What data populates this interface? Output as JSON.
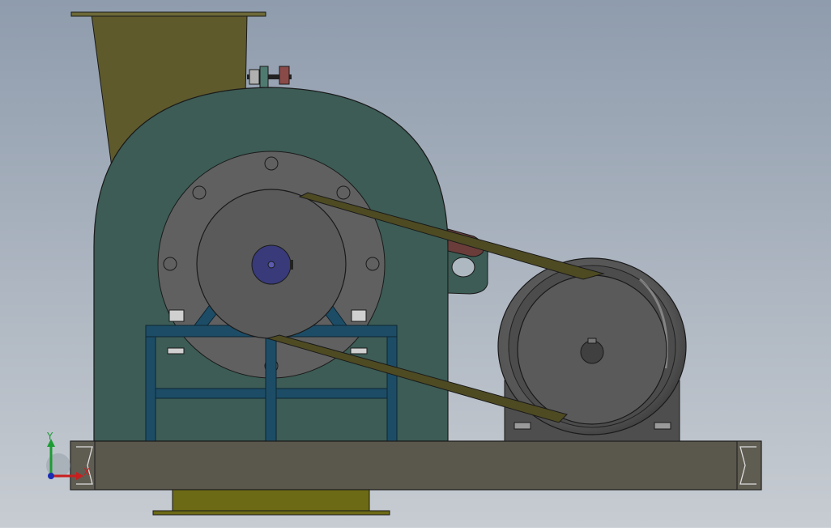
{
  "viewport": {
    "background_top": "#8f9cad",
    "background_bottom": "#c7ccd2"
  },
  "colors": {
    "hopper": "#5f5a2c",
    "hopper_flange": "#6d6a38",
    "housing": "#3c5c55",
    "outline": "#1a1a1a",
    "disc": "#606060",
    "pulley": "#5a5a5a",
    "hub": "#383a7a",
    "frame": "#1d4d66",
    "belt": "#4e4a22",
    "motor": "#5b5b5b",
    "base": "#5a574c",
    "discharge": "#6c6a14",
    "tensioner_link": "#6a3d3a",
    "tension_nut": "#8a4a48"
  },
  "triad": {
    "x_label": "X",
    "y_label": "Y",
    "x_color": "#c81e1e",
    "y_color": "#1c9c34",
    "z_color": "#1a2db4"
  }
}
